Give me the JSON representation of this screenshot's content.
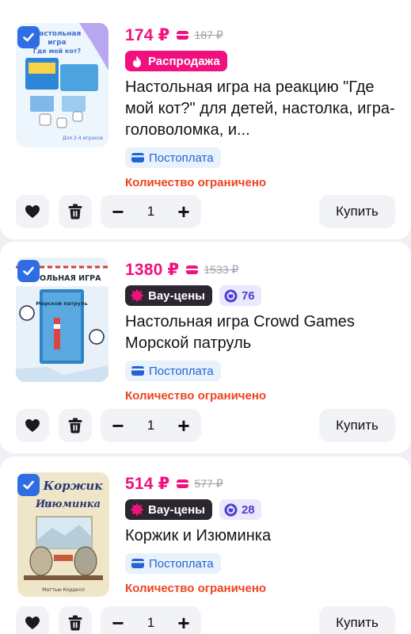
{
  "colors": {
    "accent": "#f1117e",
    "checkbox": "#2f6de5",
    "limited": "#f0421e",
    "postpay": "#2363d6",
    "wow_badge": "#2b2630",
    "points": "#4b3fd6"
  },
  "items": [
    {
      "price": "174 ₽",
      "old_price": "187 ₽",
      "badge": "Распродажа",
      "badge_icon": "fire-icon",
      "points": "",
      "title": "Настольная игра на реакцию \"Где мой кот?\" для детей, настолка, игра-головоломка, и...",
      "thumb": {
        "line1": "Настольная",
        "line2": "игра",
        "line3": "Где мой кот?",
        "footer": "Для 2-4 игроков"
      },
      "postpay": "Постоплата",
      "limited": "Количество ограничено",
      "quantity": "1",
      "buy": "Купить",
      "checked": true
    },
    {
      "price": "1380 ₽",
      "old_price": "1533 ₽",
      "badge": "Вау-цены",
      "badge_icon": "star-burst-icon",
      "points": "76",
      "title": "Настольная игра Crowd Games Морской патруль",
      "thumb": {
        "line1": "СТОЛЬНАЯ ИГРА",
        "line2": "Морской патруль"
      },
      "postpay": "Постоплата",
      "limited": "Количество ограничено",
      "quantity": "1",
      "buy": "Купить",
      "checked": true
    },
    {
      "price": "514 ₽",
      "old_price": "577 ₽",
      "badge": "Вау-цены",
      "badge_icon": "star-burst-icon",
      "points": "28",
      "title": "Коржик и Изюминка",
      "thumb": {
        "line1": "Коржик",
        "line2": "Изюминка",
        "footer": "Маттью Корделл"
      },
      "postpay": "Постоплата",
      "limited": "Количество ограничено",
      "quantity": "1",
      "buy": "Купить",
      "checked": true
    }
  ]
}
